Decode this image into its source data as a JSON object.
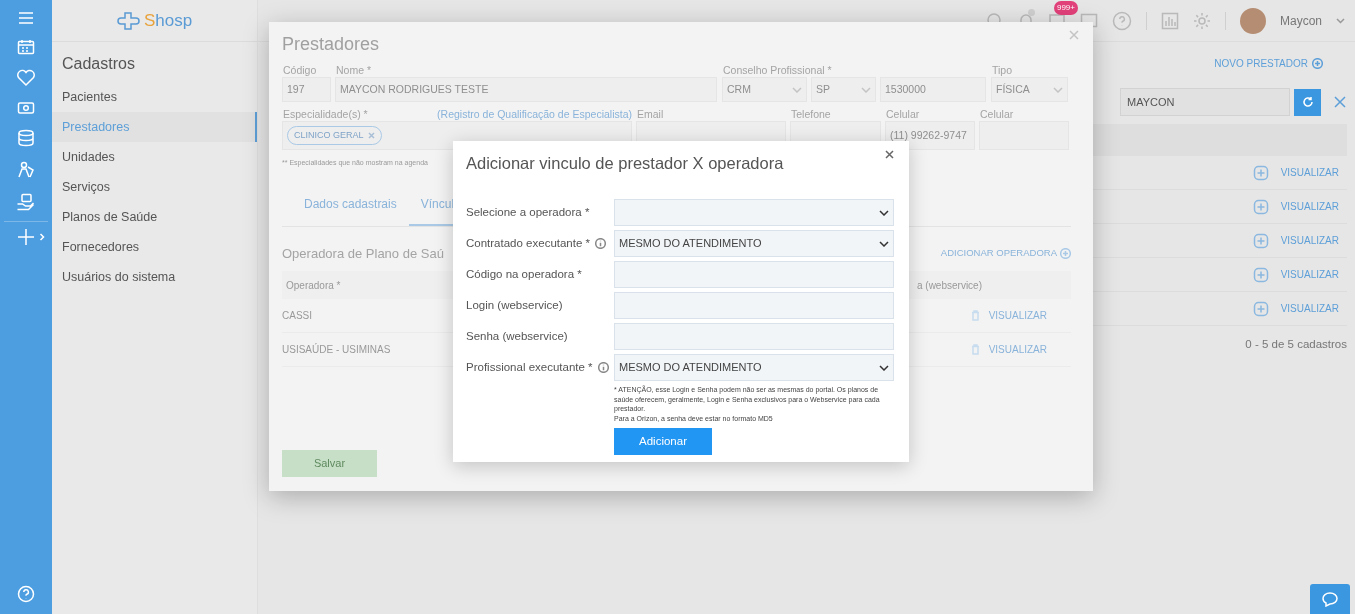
{
  "logo": {
    "text": "Shosp"
  },
  "sidebar": {
    "title": "Cadastros",
    "items": [
      {
        "label": "Pacientes",
        "selected": false
      },
      {
        "label": "Prestadores",
        "selected": true
      },
      {
        "label": "Unidades",
        "selected": false
      },
      {
        "label": "Serviços",
        "selected": false
      },
      {
        "label": "Planos de Saúde",
        "selected": false
      },
      {
        "label": "Fornecedores",
        "selected": false
      },
      {
        "label": "Usuários do sistema",
        "selected": false
      }
    ]
  },
  "topbar": {
    "notification_badge": "999+",
    "user": "Maycon"
  },
  "page": {
    "new_button": "NOVO PRESTADOR",
    "search": {
      "value": "MAYCON"
    },
    "rows": [
      {
        "action": "VISUALIZAR"
      },
      {
        "action": "VISUALIZAR"
      },
      {
        "action": "VISUALIZAR"
      },
      {
        "action": "VISUALIZAR"
      },
      {
        "action": "VISUALIZAR"
      }
    ],
    "pagination": "0 - 5 de 5 cadastros"
  },
  "provider_modal": {
    "title": "Prestadores",
    "row_1": [
      {
        "label": "Código",
        "value": "197",
        "kind": "input"
      },
      {
        "label": "Nome *",
        "value": "MAYCON RODRIGUES TESTE",
        "kind": "input"
      },
      {
        "label": "Conselho Profissional *",
        "value": "CRM",
        "kind": "select"
      },
      {
        "value": "SP",
        "kind": "select"
      },
      {
        "value": "1530000",
        "kind": "input"
      },
      {
        "label": "Tipo",
        "value": "FÍSICA",
        "kind": "select"
      }
    ],
    "specialties": {
      "label": "Especialidade(s) *",
      "link": "(Registro de Qualificação de Especialista)",
      "tags": [
        "CLINICO GERAL"
      ],
      "hint": "** Especialidades que não mostram na agenda"
    },
    "row_2": [
      {
        "label": "Email"
      },
      {
        "label": "Telefone"
      },
      {
        "label": "Celular",
        "value": "(11) 99262-9747"
      },
      {
        "label": "Celular"
      }
    ],
    "tabs": [
      {
        "label": "Dados cadastrais",
        "selected": false
      },
      {
        "label": "Víncul",
        "selected": true
      }
    ],
    "section_title": "Operadora de Plano de Saú",
    "add_link": "ADICIONAR OPERADORA",
    "table": {
      "columns": [
        "Operadora *",
        "a (webservice)"
      ],
      "rows": [
        {
          "operadora": "CASSI",
          "action": "VISUALIZAR"
        },
        {
          "operadora": "USISAÚDE - USIMINAS",
          "action": "VISUALIZAR"
        }
      ]
    },
    "save_button": "Salvar"
  },
  "link_modal": {
    "title": "Adicionar vinculo de prestador X operadora",
    "fields": [
      {
        "label": "Selecione a operadora *",
        "kind": "select",
        "info": false
      },
      {
        "label": "Contratado executante *",
        "kind": "select",
        "value": "MESMO DO ATENDIMENTO",
        "info": true
      },
      {
        "label": "Código na operadora *",
        "kind": "input",
        "info": false
      },
      {
        "label": "Login (webservice)",
        "kind": "input",
        "info": false
      },
      {
        "label": "Senha (webservice)",
        "kind": "input",
        "info": false
      },
      {
        "label": "Profissional executante *",
        "kind": "select",
        "value": "MESMO DO ATENDIMENTO",
        "info": true
      }
    ],
    "notes": [
      "* ATENÇÃO, esse Login e Senha podem não ser as mesmas do portal. Os planos de saúde oferecem, geralmente, Login e Senha exclusivos para o Webservice para cada prestador.",
      "Para a Orizon, a senha deve estar no formato MD5"
    ],
    "button": "Adicionar"
  }
}
